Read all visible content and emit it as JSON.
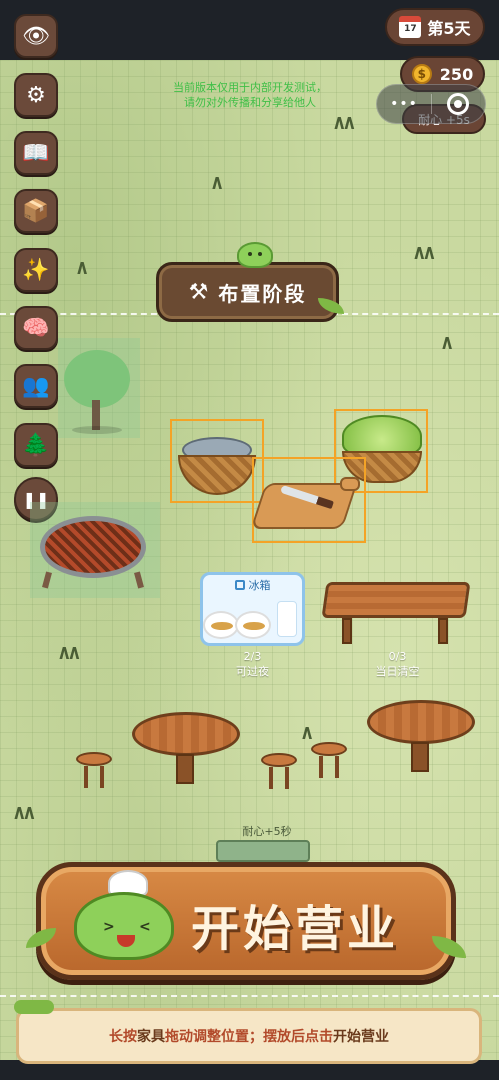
{
  "hud": {
    "day_label": "第5天",
    "coins": "250",
    "patience_badge": "耐心 +5s",
    "notice_line1": "当前版本仅用于内部开发测试，",
    "notice_line2": "请勿对外传播和分享给他人",
    "menu_dots": "•••"
  },
  "sidebar": {
    "items": [
      {
        "icon": "eye-icon",
        "glyph": "👁"
      },
      {
        "icon": "gear-icon",
        "glyph": "⚙"
      },
      {
        "icon": "book-icon",
        "glyph": "📖"
      },
      {
        "icon": "box-icon",
        "glyph": "📦"
      },
      {
        "icon": "sparkle-icon",
        "glyph": "✨"
      },
      {
        "icon": "brain-icon",
        "glyph": "🧠"
      },
      {
        "icon": "people-icon",
        "glyph": "👥"
      },
      {
        "icon": "tree-icon",
        "glyph": "🌲"
      },
      {
        "icon": "pause-icon",
        "glyph": "❚❚"
      }
    ]
  },
  "phase": {
    "title": "布置阶段",
    "icon": "tools-icon"
  },
  "fridge": {
    "label": "冰箱",
    "count": "2/3",
    "caption": "可过夜"
  },
  "counter": {
    "count": "0/3",
    "caption": "当日清空"
  },
  "bonus_label": "耐心+5秒",
  "start_button": {
    "label": "开始营业"
  },
  "hint": {
    "prefix": "长按",
    "highlight1": "家具",
    "middle": "拖动调整位置；摆放后点击",
    "highlight2": "开始营业"
  },
  "colors": {
    "accent_orange": "#f4a326",
    "wood": "#c8793f",
    "slime_green": "#8ed05a",
    "hint_red": "#c4452a"
  }
}
